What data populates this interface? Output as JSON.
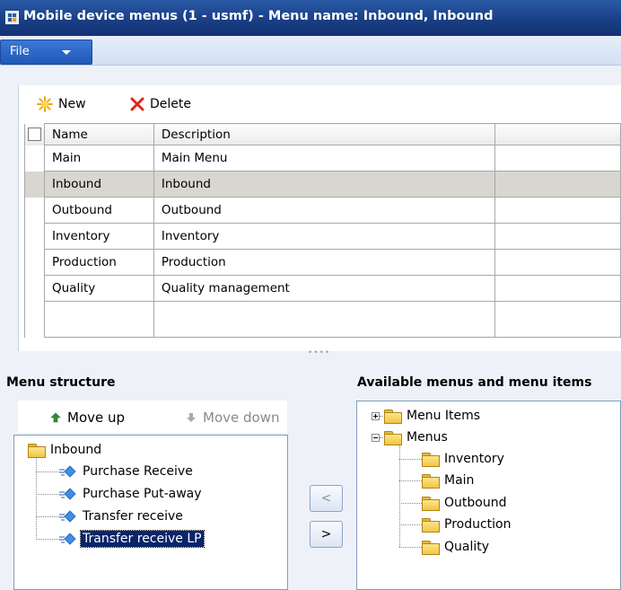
{
  "window": {
    "title": "Mobile device menus (1 - usmf) - Menu name: Inbound, Inbound"
  },
  "menu": {
    "file_label": "File"
  },
  "toolbar": {
    "new_label": "New",
    "delete_label": "Delete"
  },
  "grid": {
    "columns": [
      "Name",
      "Description"
    ],
    "rows": [
      {
        "name": "Main",
        "description": "Main Menu"
      },
      {
        "name": "Inbound",
        "description": "Inbound"
      },
      {
        "name": "Outbound",
        "description": "Outbound"
      },
      {
        "name": "Inventory",
        "description": "Inventory"
      },
      {
        "name": "Production",
        "description": "Production"
      },
      {
        "name": "Quality",
        "description": "Quality management"
      }
    ],
    "selected_row": "Inbound"
  },
  "menu_structure": {
    "label": "Menu structure",
    "move_up_label": "Move up",
    "move_down_label": "Move down",
    "root": "Inbound",
    "items": [
      "Purchase Receive",
      "Purchase Put-away",
      "Transfer receive",
      "Transfer receive LP"
    ],
    "selected_item": "Transfer receive LP"
  },
  "available": {
    "label": "Available menus and menu items",
    "menu_items_label": "Menu Items",
    "menus_label": "Menus",
    "menus": [
      "Inventory",
      "Main",
      "Outbound",
      "Production",
      "Quality"
    ]
  },
  "transfer": {
    "remove_label": "<",
    "add_label": ">"
  },
  "colors": {
    "titlebar": "#1a3f86",
    "selected_row": "#d8d6d0",
    "tree_selection": "#0a246a"
  }
}
